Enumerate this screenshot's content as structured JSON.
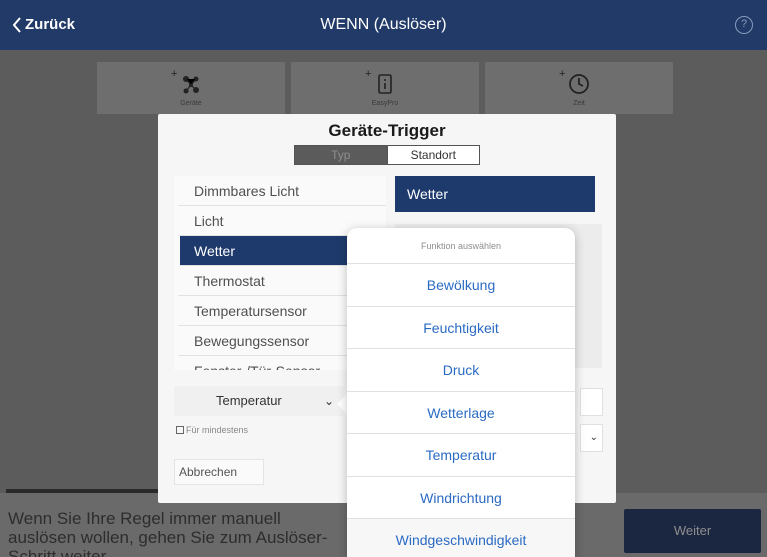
{
  "header": {
    "back_label": "Zurück",
    "title": "WENN (Auslöser)"
  },
  "tiles": [
    {
      "label": "Geräte",
      "icon": "device-nodes-icon"
    },
    {
      "label": "EasyPro",
      "icon": "remote-icon"
    },
    {
      "label": "Zeit",
      "icon": "clock-icon"
    }
  ],
  "dialog": {
    "title": "Geräte-Trigger",
    "segments": [
      "Typ",
      "Standort"
    ],
    "list": [
      "Dimmbares Licht",
      "Licht",
      "Wetter",
      "Thermostat",
      "Temperatursensor",
      "Bewegungssensor",
      "Fenster-/Tür-Sensor"
    ],
    "selected_type": "Wetter",
    "right_selected": "Wetter",
    "dropdown_value": "Temperatur",
    "checkbox_label": "Für mindestens",
    "cancel_label": "Abbrechen"
  },
  "popover": {
    "header": "Funktion auswählen",
    "items": [
      "Bewölkung",
      "Feuchtigkeit",
      "Druck",
      "Wetterlage",
      "Temperatur",
      "Windrichtung",
      "Windgeschwindigkeit"
    ]
  },
  "footer": {
    "hint": "Wenn Sie Ihre Regel immer manuell auslösen wollen, gehen Sie zum Auslöser-Schritt weiter.",
    "next_label": "Weiter"
  },
  "colors": {
    "header_bg": "#213a68",
    "selection": "#1e3a6c",
    "link_blue": "#2a6bc4"
  }
}
